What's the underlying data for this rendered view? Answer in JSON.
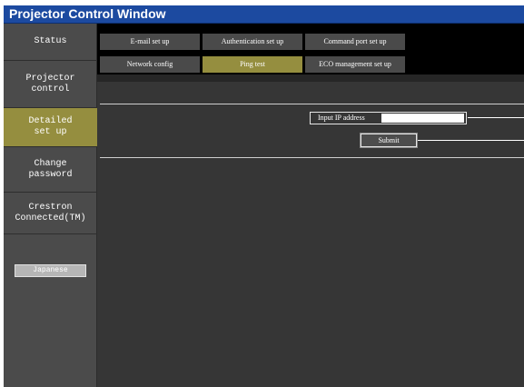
{
  "window": {
    "title": "Projector Control Window"
  },
  "sidebar": {
    "items": [
      {
        "label": "Status",
        "active": false
      },
      {
        "label": "Projector\ncontrol",
        "active": false
      },
      {
        "label": "Detailed\nset up",
        "active": true
      },
      {
        "label": "Change\npassword",
        "active": false
      },
      {
        "label": "Crestron\nConnected(TM)",
        "active": false
      }
    ],
    "language_button": "Japanese"
  },
  "tabs": [
    {
      "label": "E-mail set up",
      "active": false
    },
    {
      "label": "Authentication set up",
      "active": false
    },
    {
      "label": "Command port set up",
      "active": false
    },
    {
      "label": "Network config",
      "active": false
    },
    {
      "label": "Ping test",
      "active": true
    },
    {
      "label": "ECO management set up",
      "active": false
    }
  ],
  "ping_form": {
    "ip_label": "Input IP address",
    "ip_value": "",
    "submit_label": "Submit"
  },
  "colors": {
    "titlebar": "#1c4aa0",
    "active": "#958e3f",
    "sidebar": "#4b4b4b",
    "content": "#363636"
  }
}
